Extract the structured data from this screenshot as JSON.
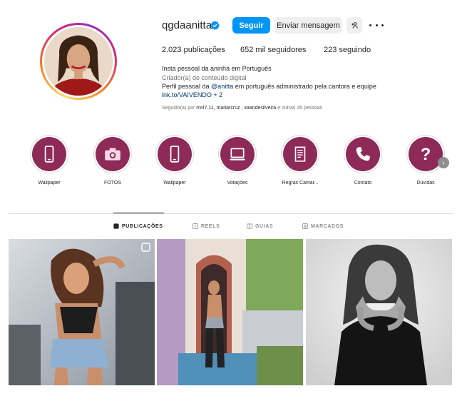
{
  "profile": {
    "username": "qgdaanitta",
    "verified": true,
    "follow_label": "Seguir",
    "message_label": "Enviar mensagem",
    "stats": {
      "posts_count": "2.023",
      "posts_label": "publicações",
      "followers_count": "652 mil",
      "followers_label": "seguidores",
      "following_count": "223",
      "following_label": "seguindo"
    },
    "full_name": "Insta pessoal da aninha em Português",
    "category": "Criador(a) de conteúdo digital",
    "bio_prefix": "Perfil pessoal da ",
    "bio_mention": "@anitta",
    "bio_suffix": " em português administrado pela cantora e equipe",
    "link": "lnk.to/VAIVENDO + 2",
    "followed_by_prefix": "Seguido(a) por ",
    "followed_by_names": "mnl7.11, mariarcruz , xaandesilveira",
    "followed_by_suffix": " e outras 35 pessoas"
  },
  "highlights": [
    {
      "label": "Wallpaper",
      "icon": "phone-icon"
    },
    {
      "label": "FOTOS",
      "icon": "camera-icon"
    },
    {
      "label": "Wallpaper",
      "icon": "phone-icon"
    },
    {
      "label": "Votações",
      "icon": "laptop-icon"
    },
    {
      "label": "Regras Camar...",
      "icon": "scroll-icon"
    },
    {
      "label": "Contato",
      "icon": "telephone-icon"
    },
    {
      "label": "Dúvidas",
      "icon": "question-icon"
    }
  ],
  "tabs": [
    {
      "label": "PUBLICAÇÕES",
      "icon": "grid-icon",
      "active": true
    },
    {
      "label": "REELS",
      "icon": "reels-icon",
      "active": false
    },
    {
      "label": "GUIAS",
      "icon": "guides-icon",
      "active": false
    },
    {
      "label": "MARCADOS",
      "icon": "tagged-icon",
      "active": false
    }
  ],
  "colors": {
    "accent": "#0095f6",
    "highlight_fill": "#8e2a58",
    "link": "#00376b"
  }
}
